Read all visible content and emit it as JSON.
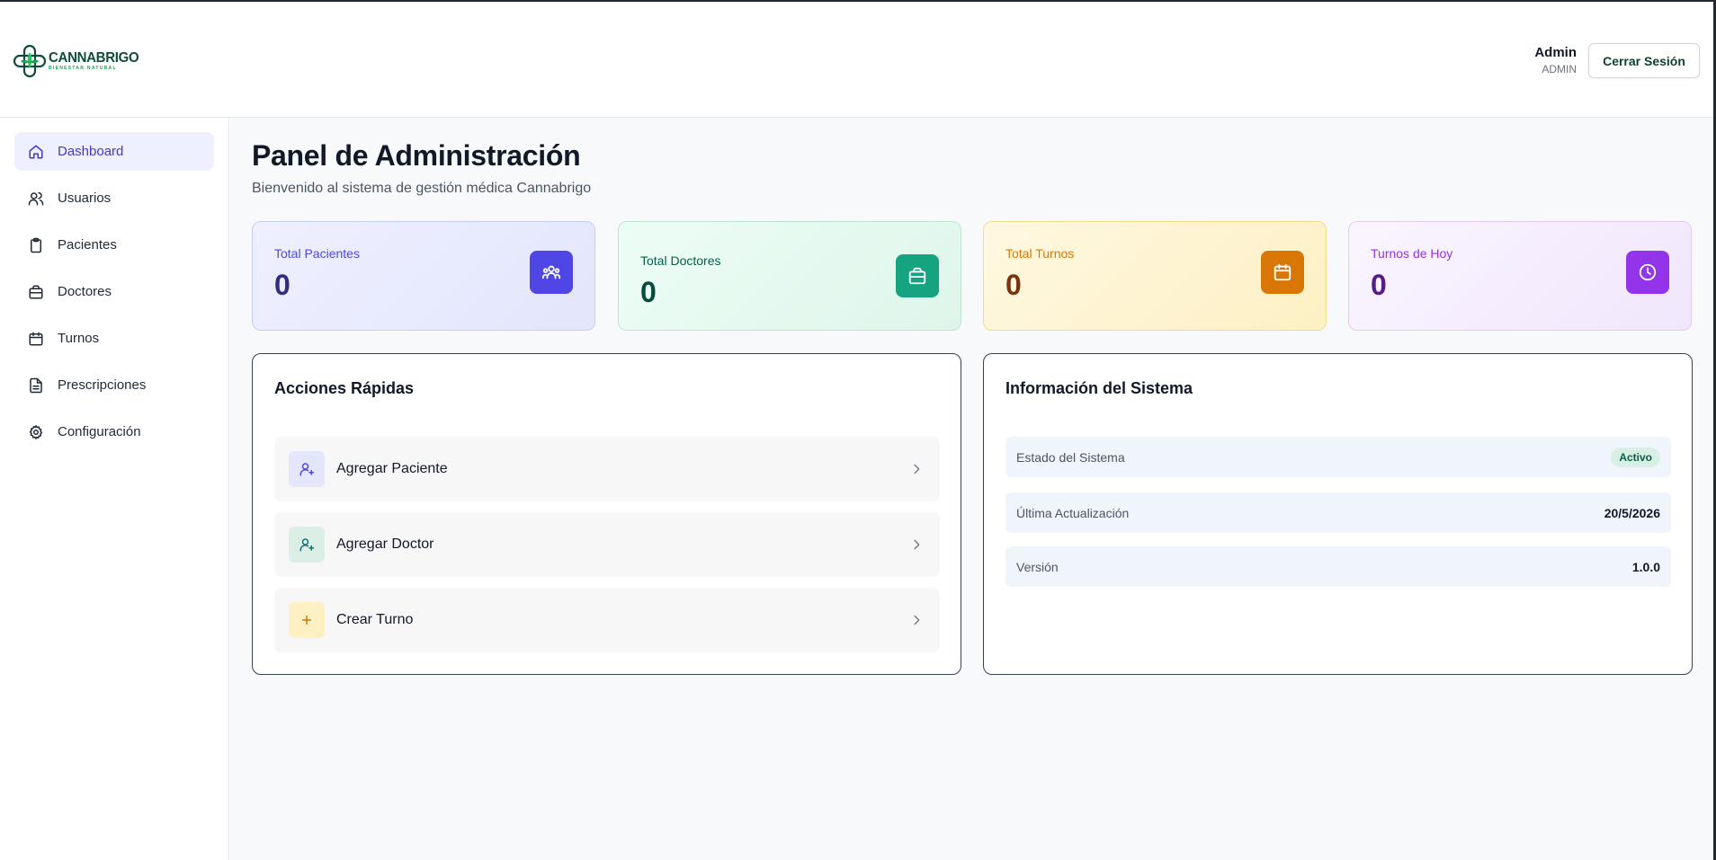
{
  "brand": {
    "name": "CANNABRIGO",
    "tagline": "BIENESTAR NATURAL",
    "accent": "#0f4c3a"
  },
  "header": {
    "user_name": "Admin",
    "user_role": "ADMIN",
    "logout_label": "Cerrar Sesión"
  },
  "sidebar": {
    "items": [
      {
        "label": "Dashboard",
        "icon": "home-icon",
        "active": true
      },
      {
        "label": "Usuarios",
        "icon": "users-icon"
      },
      {
        "label": "Pacientes",
        "icon": "clipboard-icon"
      },
      {
        "label": "Doctores",
        "icon": "briefcase-icon"
      },
      {
        "label": "Turnos",
        "icon": "calendar-icon"
      },
      {
        "label": "Prescripciones",
        "icon": "document-icon"
      },
      {
        "label": "Configuración",
        "icon": "gear-icon"
      }
    ]
  },
  "main": {
    "title": "Panel de Administración",
    "subtitle": "Bienvenido al sistema de gestión médica Cannabrigo",
    "stats": [
      {
        "label": "Total Pacientes",
        "value": "0",
        "icon": "users-group-icon",
        "color": "#4f46e5"
      },
      {
        "label": "Total Doctores",
        "value": "0",
        "icon": "briefcase-icon",
        "color": "#16a37f"
      },
      {
        "label": "Total Turnos",
        "value": "0",
        "icon": "calendar-icon",
        "color": "#d97706"
      },
      {
        "label": "Turnos de Hoy",
        "value": "0",
        "icon": "clock-icon",
        "color": "#9333ea"
      }
    ],
    "quick_actions": {
      "title": "Acciones Rápidas",
      "items": [
        {
          "label": "Agregar Paciente",
          "icon": "user-plus-icon"
        },
        {
          "label": "Agregar Doctor",
          "icon": "user-plus-icon"
        },
        {
          "label": "Crear Turno",
          "icon": "plus-icon"
        }
      ]
    },
    "system_info": {
      "title": "Información del Sistema",
      "rows": [
        {
          "label": "Estado del Sistema",
          "value": "Activo"
        },
        {
          "label": "Última Actualización",
          "value": "20/5/2026"
        },
        {
          "label": "Versión",
          "value": "1.0.0"
        }
      ]
    }
  }
}
